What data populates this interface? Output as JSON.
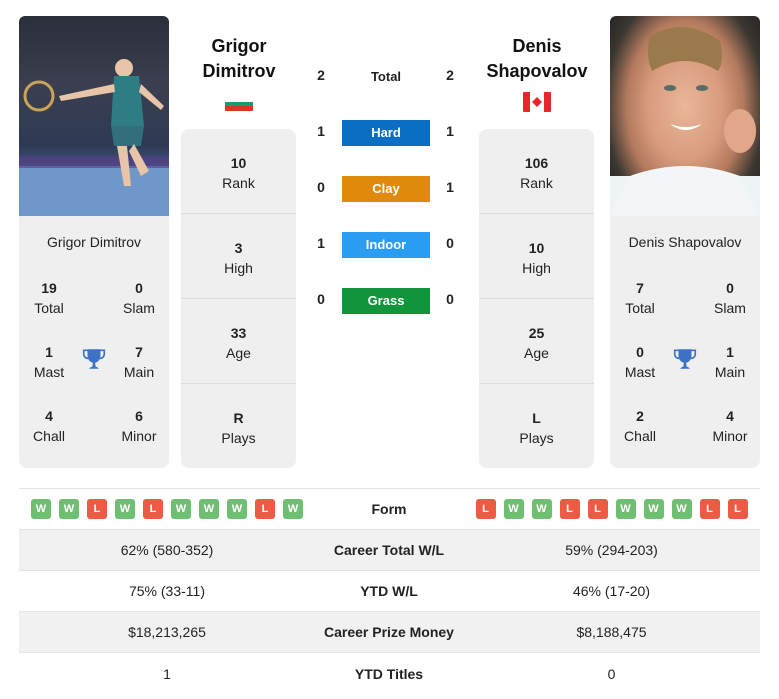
{
  "colors": {
    "hard": "#0a6ec2",
    "clay": "#e08a0b",
    "indoor": "#2a9cf2",
    "grass": "#11953a",
    "win": "#6fbf73",
    "loss": "#ee5b45",
    "trophy": "#3b72c4"
  },
  "player1": {
    "first_name": "Grigor",
    "last_name": "Dimitrov",
    "full_name": "Grigor Dimitrov",
    "flag": "Bulgaria",
    "photo_alt": "Grigor Dimitrov photo",
    "titles": {
      "total": {
        "value": "19",
        "label": "Total"
      },
      "slam": {
        "value": "0",
        "label": "Slam"
      },
      "mast": {
        "value": "1",
        "label": "Mast"
      },
      "main": {
        "value": "7",
        "label": "Main"
      },
      "chall": {
        "value": "4",
        "label": "Chall"
      },
      "minor": {
        "value": "6",
        "label": "Minor"
      }
    },
    "info": [
      {
        "value": "10",
        "label": "Rank"
      },
      {
        "value": "3",
        "label": "High"
      },
      {
        "value": "33",
        "label": "Age"
      },
      {
        "value": "R",
        "label": "Plays"
      }
    ],
    "form": [
      "W",
      "W",
      "L",
      "W",
      "L",
      "W",
      "W",
      "W",
      "L",
      "W"
    ]
  },
  "player2": {
    "first_name": "Denis",
    "last_name": "Shapovalov",
    "full_name": "Denis Shapovalov",
    "flag": "Canada",
    "photo_alt": "Denis Shapovalov photo",
    "titles": {
      "total": {
        "value": "7",
        "label": "Total"
      },
      "slam": {
        "value": "0",
        "label": "Slam"
      },
      "mast": {
        "value": "0",
        "label": "Mast"
      },
      "main": {
        "value": "1",
        "label": "Main"
      },
      "chall": {
        "value": "2",
        "label": "Chall"
      },
      "minor": {
        "value": "4",
        "label": "Minor"
      }
    },
    "info": [
      {
        "value": "106",
        "label": "Rank"
      },
      {
        "value": "10",
        "label": "High"
      },
      {
        "value": "25",
        "label": "Age"
      },
      {
        "value": "L",
        "label": "Plays"
      }
    ],
    "form": [
      "L",
      "W",
      "W",
      "L",
      "L",
      "W",
      "W",
      "W",
      "L",
      "L"
    ]
  },
  "h2h": {
    "total": {
      "label": "Total",
      "p1": "2",
      "p2": "2"
    },
    "surfaces": [
      {
        "label": "Hard",
        "p1": "1",
        "p2": "1"
      },
      {
        "label": "Clay",
        "p1": "0",
        "p2": "1"
      },
      {
        "label": "Indoor",
        "p1": "1",
        "p2": "0"
      },
      {
        "label": "Grass",
        "p1": "0",
        "p2": "0"
      }
    ]
  },
  "comparison": {
    "form_label": "Form",
    "rows": [
      {
        "label": "Career Total W/L",
        "p1": "62% (580-352)",
        "p2": "59% (294-203)"
      },
      {
        "label": "YTD W/L",
        "p1": "75% (33-11)",
        "p2": "46% (17-20)"
      },
      {
        "label": "Career Prize Money",
        "p1": "$18,213,265",
        "p2": "$8,188,475"
      },
      {
        "label": "YTD Titles",
        "p1": "1",
        "p2": "0"
      }
    ]
  }
}
